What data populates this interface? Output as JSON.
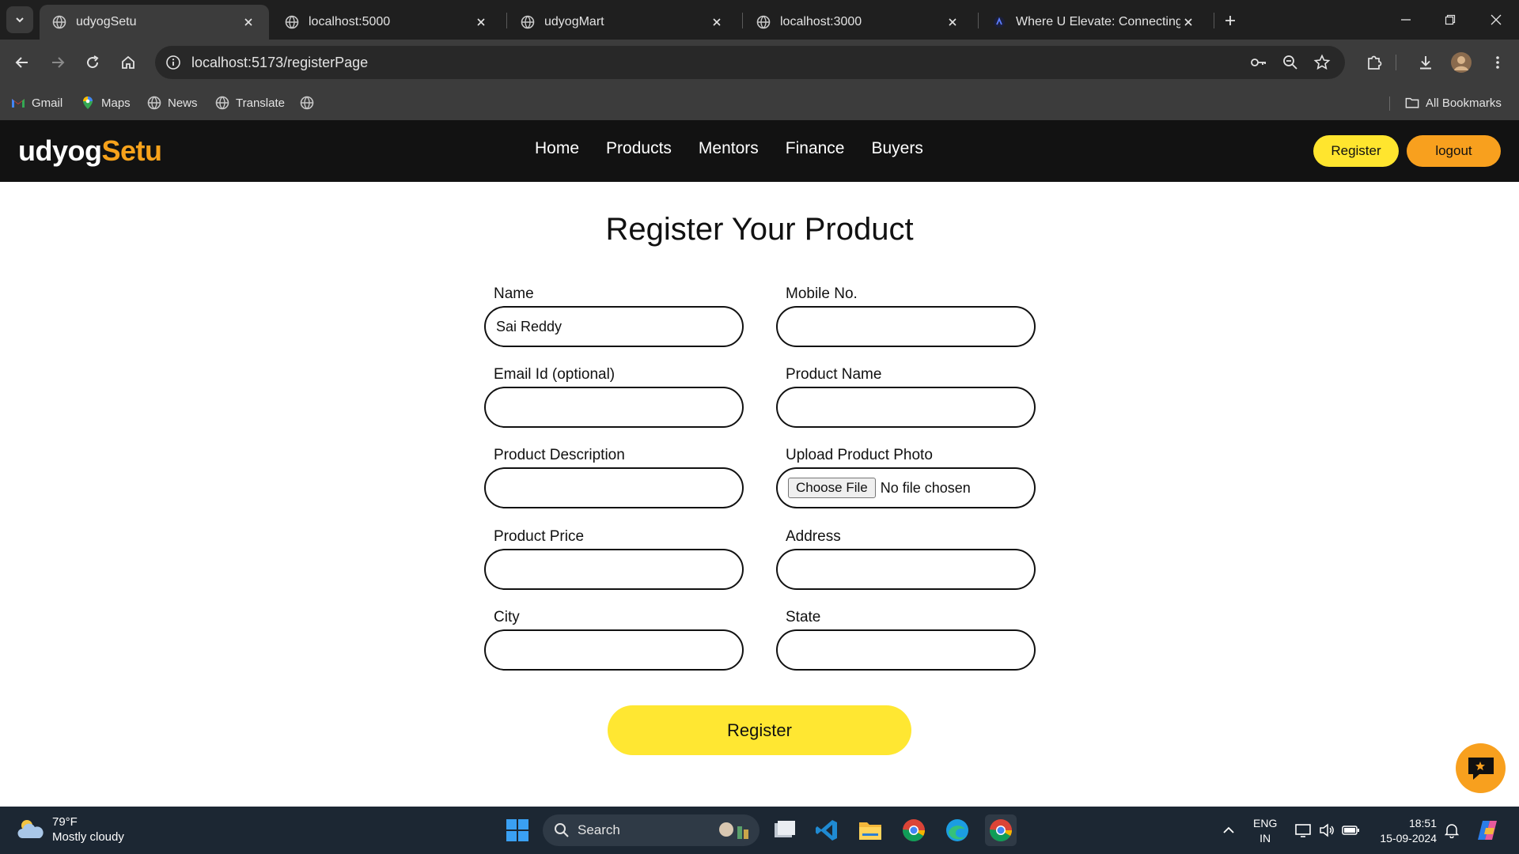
{
  "browser": {
    "tabs": [
      {
        "title": "udyogSetu",
        "active": true
      },
      {
        "title": "localhost:5000",
        "active": false
      },
      {
        "title": "udyogMart",
        "active": false
      },
      {
        "title": "localhost:3000",
        "active": false
      },
      {
        "title": "Where U Elevate: Connecting ne",
        "active": false
      }
    ],
    "url": "localhost:5173/registerPage",
    "bookmarks": [
      "Gmail",
      "Maps",
      "News",
      "Translate"
    ],
    "all_bookmarks": "All Bookmarks"
  },
  "site": {
    "logo_main": "udyog",
    "logo_accent": "Setu",
    "nav": [
      "Home",
      "Products",
      "Mentors",
      "Finance",
      "Buyers"
    ],
    "register_btn": "Register",
    "logout_btn": "logout",
    "accent_color": "#f7a21b",
    "yellow": "#ffe52e"
  },
  "form": {
    "title": "Register Your Product",
    "name_label": "Name",
    "name_value": "Sai Reddy",
    "mobile_label": "Mobile No.",
    "email_label": "Email Id (optional)",
    "product_name_label": "Product Name",
    "description_label": "Product Description",
    "photo_label": "Upload Product Photo",
    "choose_file": "Choose File",
    "no_file": "No file chosen",
    "price_label": "Product Price",
    "address_label": "Address",
    "city_label": "City",
    "state_label": "State",
    "submit": "Register"
  },
  "taskbar": {
    "temperature": "79°F",
    "weather": "Mostly cloudy",
    "search": "Search",
    "lang": "ENG",
    "region": "IN",
    "time": "18:51",
    "date": "15-09-2024"
  }
}
